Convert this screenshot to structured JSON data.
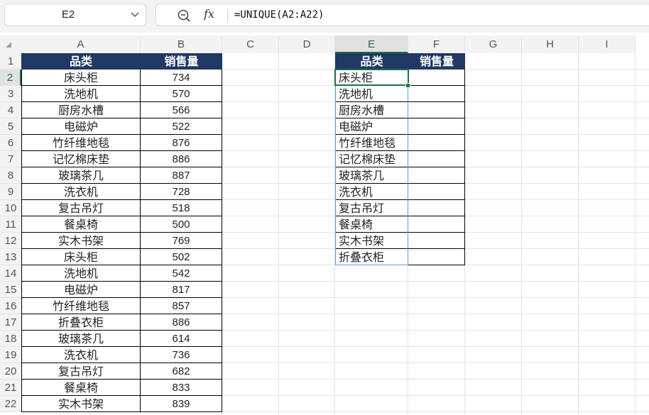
{
  "name_box": {
    "value": "E2"
  },
  "formula_bar": {
    "formula": "=UNIQUE(A2:A22)",
    "fx_label": "fx"
  },
  "columns": [
    "A",
    "B",
    "C",
    "D",
    "E",
    "F",
    "G",
    "H",
    "I"
  ],
  "selected_column": "E",
  "selected_row": "2",
  "rows": [
    "1",
    "2",
    "3",
    "4",
    "5",
    "6",
    "7",
    "8",
    "9",
    "10",
    "11",
    "12",
    "13",
    "14",
    "15",
    "16",
    "17",
    "18",
    "19",
    "20",
    "21",
    "22"
  ],
  "source_table": {
    "headers": [
      "品类",
      "销售量"
    ],
    "rows": [
      [
        "床头柜",
        "734"
      ],
      [
        "洗地机",
        "570"
      ],
      [
        "厨房水槽",
        "566"
      ],
      [
        "电磁炉",
        "522"
      ],
      [
        "竹纤维地毯",
        "876"
      ],
      [
        "记忆棉床垫",
        "886"
      ],
      [
        "玻璃茶几",
        "887"
      ],
      [
        "洗衣机",
        "728"
      ],
      [
        "复古吊灯",
        "518"
      ],
      [
        "餐桌椅",
        "500"
      ],
      [
        "实木书架",
        "769"
      ],
      [
        "床头柜",
        "502"
      ],
      [
        "洗地机",
        "542"
      ],
      [
        "电磁炉",
        "817"
      ],
      [
        "竹纤维地毯",
        "857"
      ],
      [
        "折叠衣柜",
        "886"
      ],
      [
        "玻璃茶几",
        "614"
      ],
      [
        "洗衣机",
        "736"
      ],
      [
        "复古吊灯",
        "682"
      ],
      [
        "餐桌椅",
        "833"
      ],
      [
        "实木书架",
        "839"
      ]
    ]
  },
  "result_table": {
    "headers": [
      "品类",
      "销售量"
    ],
    "categories": [
      "床头柜",
      "洗地机",
      "厨房水槽",
      "电磁炉",
      "竹纤维地毯",
      "记忆棉床垫",
      "玻璃茶几",
      "洗衣机",
      "复古吊灯",
      "餐桌椅",
      "实木书架",
      "折叠衣柜"
    ]
  },
  "colors": {
    "header_fill": "#203864",
    "accent": "#1e7145",
    "spill_border": "#5b9bd5"
  }
}
